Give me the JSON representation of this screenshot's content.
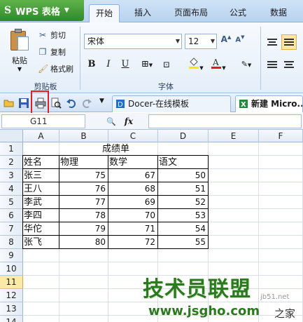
{
  "app": {
    "name": "WPS 表格",
    "logo_glyph": "S",
    "menu_arrow": "▼",
    "accent": "#3c9a32"
  },
  "menu_tabs": [
    "开始",
    "插入",
    "页面布局",
    "公式",
    "数据"
  ],
  "ribbon": {
    "clipboard": {
      "paste_label": "粘贴",
      "cut_label": "剪切",
      "copy_label": "复制",
      "format_painter_label": "格式刷",
      "group_label": "剪贴板"
    },
    "font": {
      "font_name": "宋体",
      "font_size": "12",
      "bold": "B",
      "italic": "I",
      "underline": "U",
      "grow": "A",
      "shrink": "A",
      "group_label": "字体",
      "font_color": "#e01b1b",
      "fill_color": "#ffe600"
    },
    "alignment": {
      "active": "center"
    }
  },
  "quick_access": {
    "doc_tabs": [
      {
        "label": "Docer-在线模板",
        "active": false
      },
      {
        "label": "新建 Micro...",
        "active": true
      }
    ]
  },
  "formula_bar": {
    "cell_ref": "G11",
    "fx_label": "fx"
  },
  "sheet": {
    "columns": [
      "A",
      "B",
      "C",
      "D",
      "E",
      "F"
    ],
    "rows": [
      "1",
      "2",
      "3",
      "4",
      "5",
      "6",
      "7",
      "8",
      "9",
      "10",
      "11",
      "12",
      "13",
      "14"
    ],
    "selected_row": "11",
    "title": "成绩单",
    "headers": [
      "姓名",
      "物理",
      "数学",
      "语文"
    ],
    "records": [
      [
        "张三",
        "75",
        "67",
        "50"
      ],
      [
        "王八",
        "76",
        "68",
        "51"
      ],
      [
        "李武",
        "77",
        "69",
        "52"
      ],
      [
        "李四",
        "78",
        "70",
        "53"
      ],
      [
        "华佗",
        "79",
        "71",
        "54"
      ],
      [
        "张飞",
        "80",
        "72",
        "55"
      ]
    ]
  },
  "watermark": {
    "brand": "技术员联盟",
    "url": "www.jsgho.com",
    "small": "jb51.net",
    "home": "之家"
  }
}
